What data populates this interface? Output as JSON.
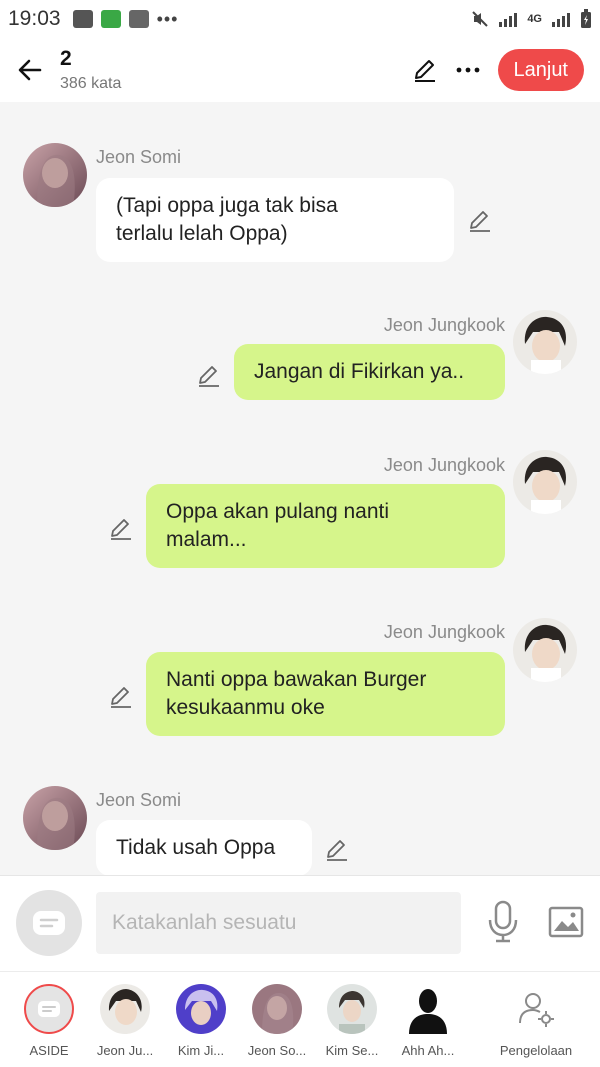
{
  "status_bar": {
    "time": "19:03",
    "network": "4G"
  },
  "header": {
    "title": "2",
    "subtitle": "386 kata",
    "next_button": "Lanjut",
    "accent_color": "#ef4a4a"
  },
  "messages": [
    {
      "side": "left",
      "sender": "Jeon Somi",
      "text_lines": [
        "(Tapi oppa juga tak bisa",
        "terlalu lelah Oppa)"
      ]
    },
    {
      "side": "right",
      "sender": "Jeon Jungkook",
      "text_lines": [
        "Jangan di Fikirkan ya.."
      ]
    },
    {
      "side": "right",
      "sender": "Jeon Jungkook",
      "text_lines": [
        "Oppa akan pulang nanti",
        "malam..."
      ]
    },
    {
      "side": "right",
      "sender": "Jeon Jungkook",
      "text_lines": [
        "Nanti oppa bawakan Burger",
        "kesukaanmu oke"
      ]
    },
    {
      "side": "left",
      "sender": "Jeon Somi",
      "text_lines": [
        "Tidak usah Oppa"
      ]
    }
  ],
  "composer": {
    "placeholder": "Katakanlah sesuatu"
  },
  "cast_bar": [
    {
      "label": "ASIDE",
      "icon": "aside-chat-icon"
    },
    {
      "label": "Jeon Ju...",
      "icon": "avatar"
    },
    {
      "label": "Kim Ji...",
      "icon": "avatar"
    },
    {
      "label": "Jeon So...",
      "icon": "avatar"
    },
    {
      "label": "Kim Se...",
      "icon": "avatar"
    },
    {
      "label": "Ahh Ah...",
      "icon": "silhouette-icon"
    },
    {
      "label": "Pengelolaan",
      "icon": "user-settings-icon"
    }
  ],
  "colors": {
    "left_bubble": "#ffffff",
    "right_bubble": "#d6f58b",
    "background": "#f5f5f5"
  }
}
